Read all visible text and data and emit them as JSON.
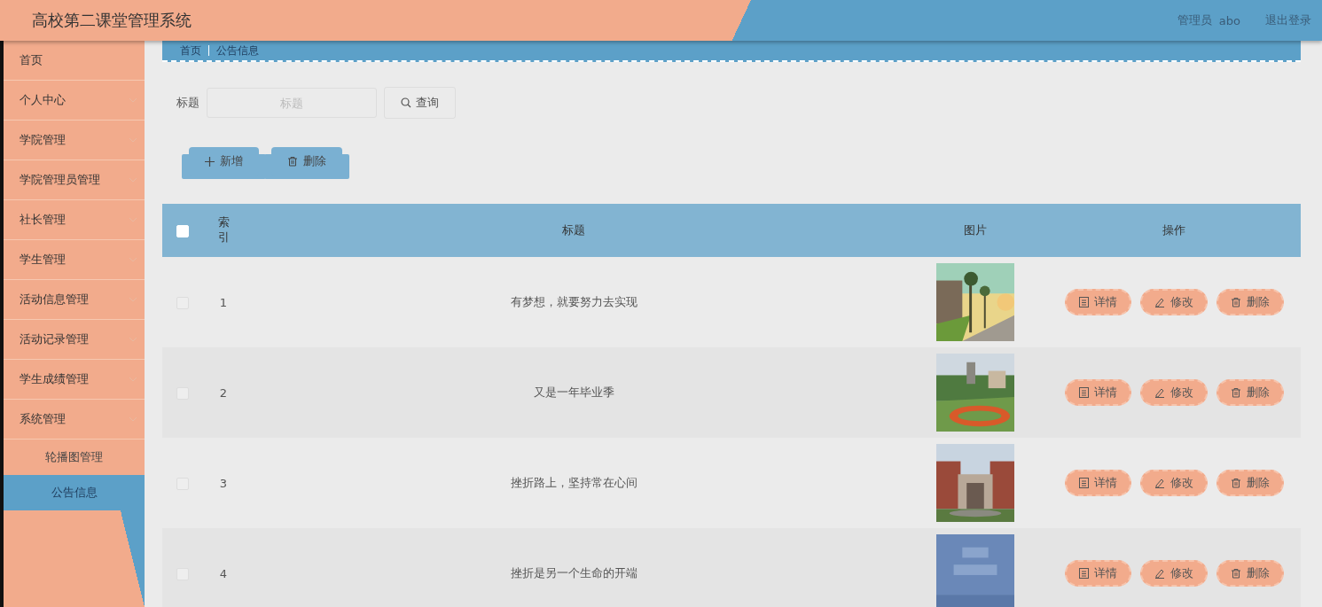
{
  "header": {
    "title": "高校第二课堂管理系统",
    "role": "管理员",
    "user": "abo",
    "logout": "退出登录"
  },
  "breadcrumb": [
    "首页",
    "公告信息"
  ],
  "sidebar": {
    "items": [
      {
        "label": "首页",
        "expandable": false
      },
      {
        "label": "个人中心",
        "expandable": true
      },
      {
        "label": "学院管理",
        "expandable": true
      },
      {
        "label": "学院管理员管理",
        "expandable": true
      },
      {
        "label": "社长管理",
        "expandable": true
      },
      {
        "label": "学生管理",
        "expandable": true
      },
      {
        "label": "活动信息管理",
        "expandable": true
      },
      {
        "label": "活动记录管理",
        "expandable": true
      },
      {
        "label": "学生成绩管理",
        "expandable": true
      },
      {
        "label": "系统管理",
        "expandable": true,
        "expanded": true,
        "children": [
          {
            "label": "轮播图管理",
            "selected": false
          },
          {
            "label": "公告信息",
            "selected": true
          }
        ]
      }
    ]
  },
  "search": {
    "label": "标题",
    "placeholder": "标题",
    "button": "查询"
  },
  "toolbar": [
    {
      "kind": "add",
      "label": "新增"
    },
    {
      "kind": "delete",
      "label": "删除"
    }
  ],
  "table": {
    "select_all": {
      "checked": false
    },
    "columns": [
      "索引",
      "标题",
      "图片",
      "操作"
    ],
    "rows": [
      {
        "checked": false,
        "index": "1",
        "title": "有梦想，就要努力去实现",
        "image": {
          "kind": "picture"
        },
        "actions": [
          {
            "kind": "detail",
            "label": "详情"
          },
          {
            "kind": "edit",
            "label": "修改"
          },
          {
            "kind": "delete",
            "label": "删除"
          }
        ]
      },
      {
        "checked": false,
        "index": "2",
        "title": "又是一年毕业季",
        "image": {
          "kind": "picture"
        },
        "actions": [
          {
            "kind": "detail",
            "label": "详情"
          },
          {
            "kind": "edit",
            "label": "修改"
          },
          {
            "kind": "delete",
            "label": "删除"
          }
        ]
      },
      {
        "checked": false,
        "index": "3",
        "title": "挫折路上，坚持常在心间",
        "image": {
          "kind": "picture"
        },
        "actions": [
          {
            "kind": "detail",
            "label": "详情"
          },
          {
            "kind": "edit",
            "label": "修改"
          },
          {
            "kind": "delete",
            "label": "删除"
          }
        ]
      },
      {
        "checked": false,
        "index": "4",
        "title": "挫折是另一个生命的开端",
        "image": {
          "kind": "picture"
        },
        "actions": [
          {
            "kind": "detail",
            "label": "详情"
          },
          {
            "kind": "edit",
            "label": "修改"
          },
          {
            "kind": "delete",
            "label": "删除"
          }
        ]
      }
    ]
  }
}
